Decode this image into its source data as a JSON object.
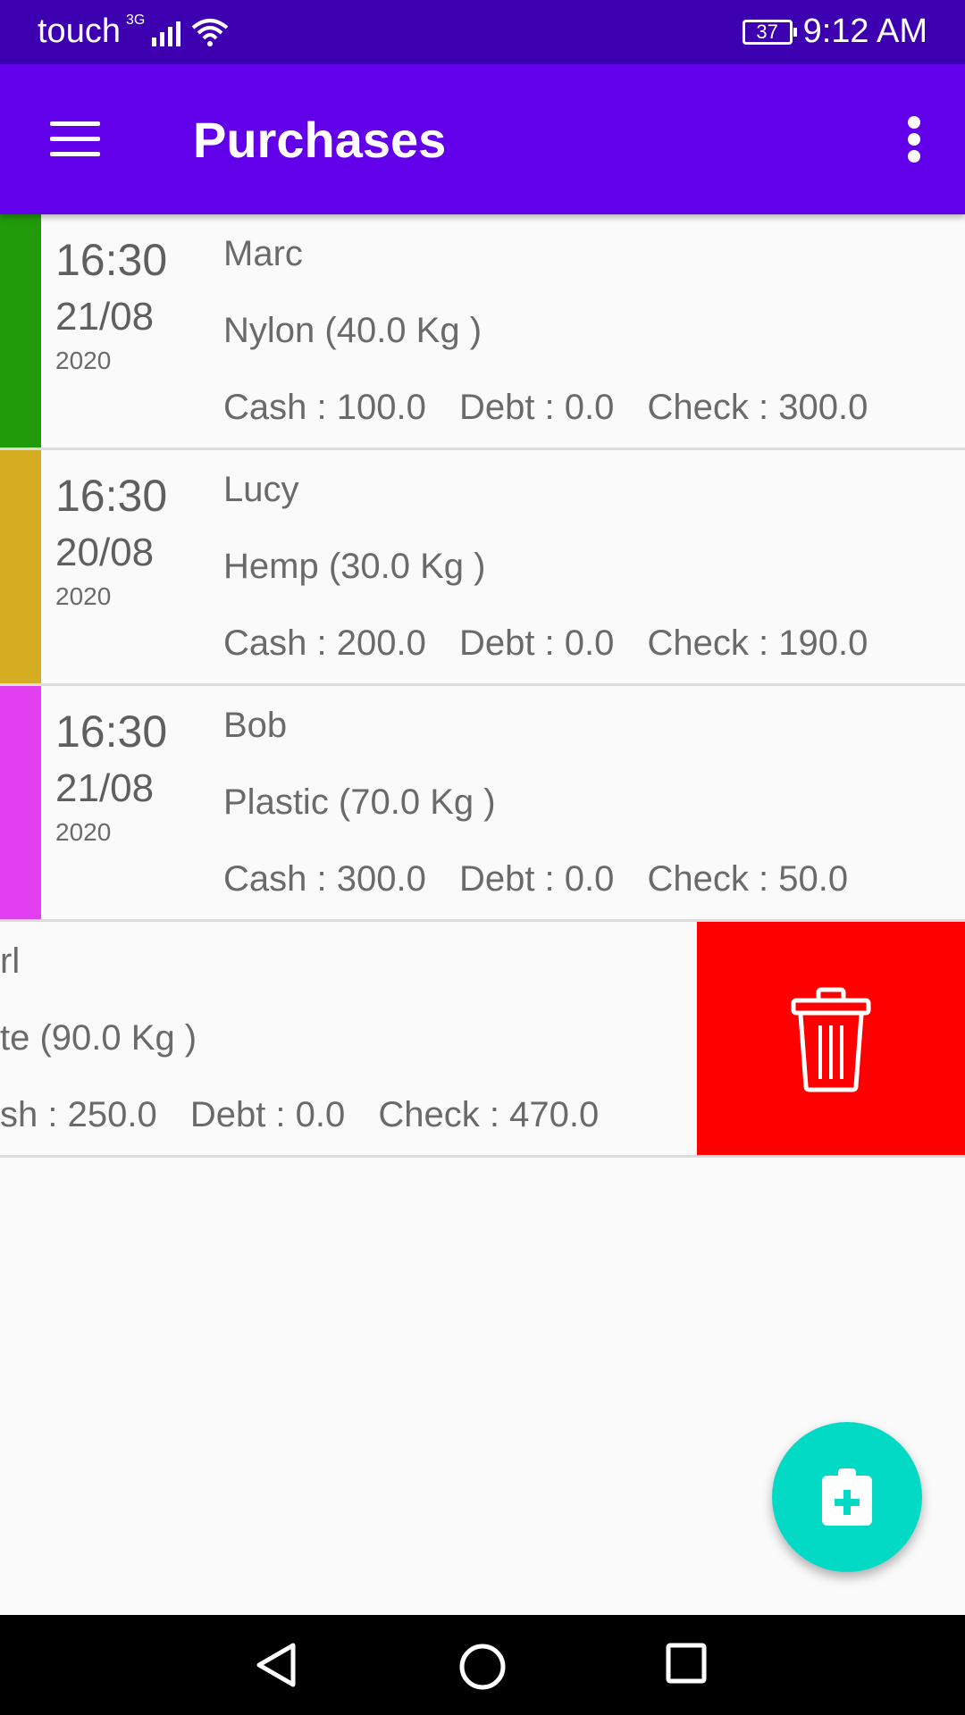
{
  "status_bar": {
    "carrier": "touch",
    "network": "3G",
    "battery": "37",
    "time": "9:12 AM"
  },
  "app_bar": {
    "title": "Purchases",
    "menu_icon": "hamburger-menu-icon",
    "overflow_icon": "more-vert-icon"
  },
  "purchases": [
    {
      "color": "#229b0a",
      "time": "16:30",
      "date": "21/08",
      "year": "2020",
      "name": "Marc",
      "product": "Nylon (40.0 Kg )",
      "cash": "Cash : 100.0",
      "debt": "Debt : 0.0",
      "check": "Check : 300.0"
    },
    {
      "color": "#d4ad20",
      "time": "16:30",
      "date": "20/08",
      "year": "2020",
      "name": "Lucy",
      "product": "Hemp (30.0 Kg )",
      "cash": "Cash : 200.0",
      "debt": "Debt : 0.0",
      "check": "Check : 190.0"
    },
    {
      "color": "#e23ff0",
      "time": "16:30",
      "date": "21/08",
      "year": "2020",
      "name": "Bob",
      "product": "Plastic (70.0 Kg )",
      "cash": "Cash : 300.0",
      "debt": "Debt : 0.0",
      "check": "Check : 50.0"
    }
  ],
  "swiped_row": {
    "name": "rl",
    "product": "te (90.0 Kg )",
    "cash": "sh : 250.0",
    "debt": "Debt : 0.0",
    "check": "Check : 470.0",
    "delete_color": "#ff0000",
    "delete_icon": "trash-icon"
  },
  "fab": {
    "icon": "clipboard-add-icon",
    "color": "#03dac5"
  },
  "nav": {
    "back": "back-icon",
    "home": "home-icon",
    "recents": "recents-icon"
  }
}
